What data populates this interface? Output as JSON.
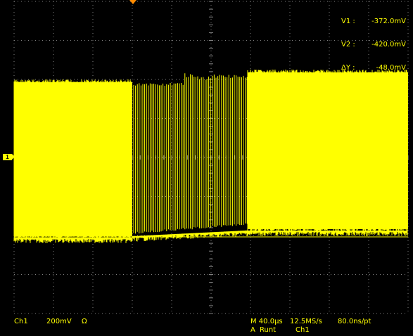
{
  "cursor_readout": {
    "v1_label": "V1 :",
    "v1_value": "-372.0mV",
    "v2_label": "V2 :",
    "v2_value": "-420.0mV",
    "dv_label": "ΔY :",
    "dv_value": "-48.0mV"
  },
  "channel_marker": {
    "label": "1"
  },
  "status_bar": {
    "channel": "Ch1",
    "volts_per_div": "200mV",
    "coupling_icon": "ohm-icon",
    "coupling_symbol": "Ω",
    "timebase": "M 40.0µs",
    "sample_rate": "12.5MS/s",
    "time_per_point": "80.0ns/pt",
    "trigger_mode": "A",
    "trigger_type": "Runt",
    "trigger_source": "Ch1"
  },
  "colors": {
    "trace": "#ffff00",
    "grid": "#808080",
    "trigger_marker": "#ff8c00",
    "background": "#000000"
  },
  "grid": {
    "horizontal_divisions": 10,
    "vertical_divisions": 8
  }
}
